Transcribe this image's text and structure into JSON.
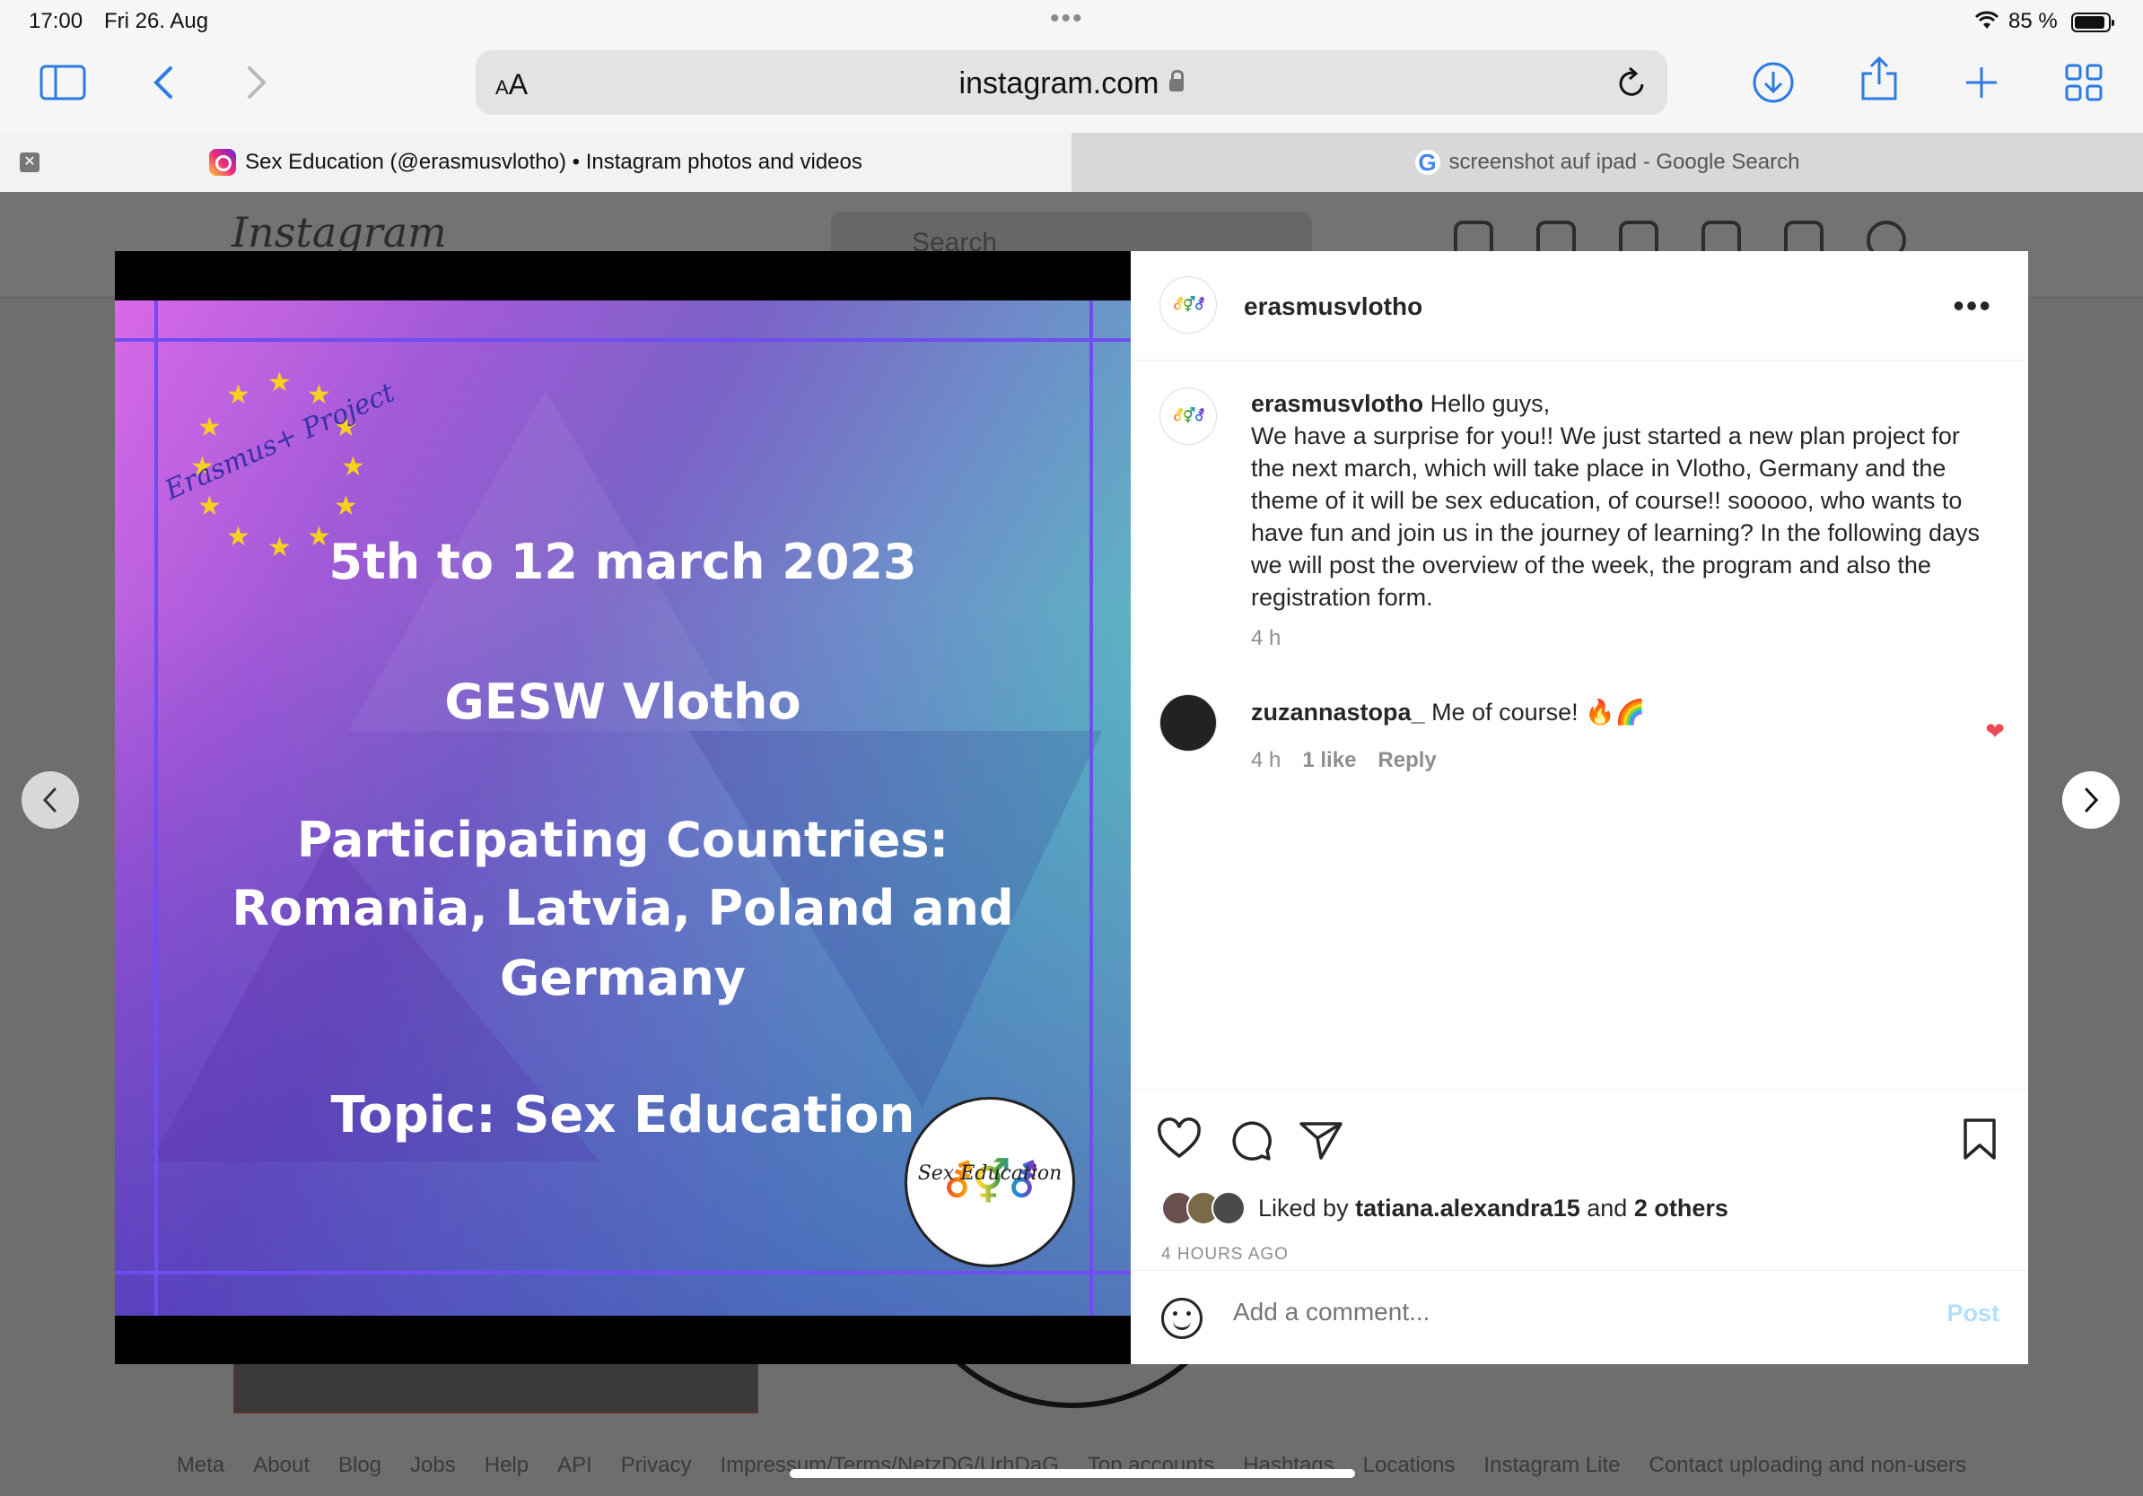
{
  "status": {
    "time": "17:00",
    "date": "Fri 26. Aug",
    "battery": "85 %"
  },
  "browser": {
    "url": "instagram.com",
    "tabs": [
      {
        "title": "Sex Education (@erasmusvlotho) • Instagram photos and videos"
      },
      {
        "title": "screenshot auf ipad - Google Search"
      }
    ]
  },
  "background": {
    "logo": "Instagram",
    "search_placeholder": "Search",
    "footer": [
      "Meta",
      "About",
      "Blog",
      "Jobs",
      "Help",
      "API",
      "Privacy",
      "Impressum/Terms/NetzDG/UrhDaG",
      "Top accounts",
      "Hashtags",
      "Locations",
      "Instagram Lite",
      "Contact uploading and non-users"
    ]
  },
  "post": {
    "image": {
      "corner_text": "Erasmus+ Project",
      "line1": "5th to 12 march 2023",
      "line2": "GESW Vlotho",
      "line3": "Participating Countries:",
      "line4": "Romania, Latvia, Poland and",
      "line5": "Germany",
      "line6": "Topic: Sex Education",
      "badge_text": "Sex Education"
    },
    "author": "erasmusvlotho",
    "caption_first": "Hello guys,",
    "caption_body": "We have a surprise for you!! We just started a new plan project for the next march, which will take place in Vlotho, Germany and the theme of it will be sex education, of course!! sooooo, who wants to have fun and join us in the journey of learning? In the following days we will post the overview of the week, the program and also the registration form.",
    "caption_time": "4 h",
    "comment": {
      "user": "zuzannastopa_",
      "text": "Me of course! 🔥🌈",
      "time": "4 h",
      "likes": "1 like",
      "reply": "Reply"
    },
    "liked_prefix": "Liked by",
    "liked_user": "tatiana.alexandra15",
    "liked_and": "and",
    "liked_others": "2 others",
    "posted_ago": "4 HOURS AGO",
    "comment_placeholder": "Add a comment...",
    "post_button": "Post"
  }
}
